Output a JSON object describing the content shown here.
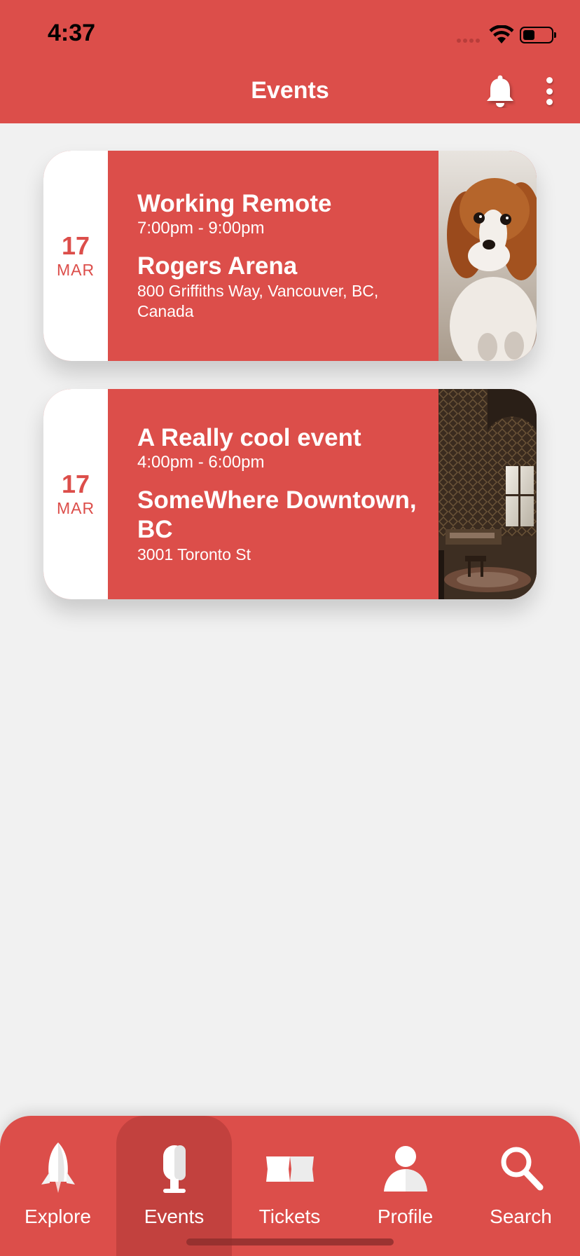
{
  "status_bar": {
    "time": "4:37"
  },
  "header": {
    "title": "Events",
    "icons": [
      "bell-icon",
      "more-vertical-icon"
    ]
  },
  "events": [
    {
      "day": "17",
      "month": "MAR",
      "title": "Working Remote",
      "time": "7:00pm - 9:00pm",
      "venue": "Rogers Arena",
      "address": "800 Griffiths Way, Vancouver, BC, Canada",
      "image": "dog-photo"
    },
    {
      "day": "17",
      "month": "MAR",
      "title": "A Really cool event",
      "time": "4:00pm - 6:00pm",
      "venue": "SomeWhere Downtown, BC",
      "address": "3001 Toronto St",
      "image": "room-interior-photo"
    }
  ],
  "tab_bar": {
    "active": "Events",
    "tabs": [
      {
        "label": "Explore",
        "icon": "rocket-icon"
      },
      {
        "label": "Events",
        "icon": "microphone-icon"
      },
      {
        "label": "Tickets",
        "icon": "ticket-icon"
      },
      {
        "label": "Profile",
        "icon": "person-icon"
      },
      {
        "label": "Search",
        "icon": "search-icon"
      }
    ]
  },
  "colors": {
    "primary": "#dc4e4a",
    "active_tab": "#c2413e",
    "background": "#f1f1f1",
    "card_date_bg": "#ffffff"
  }
}
